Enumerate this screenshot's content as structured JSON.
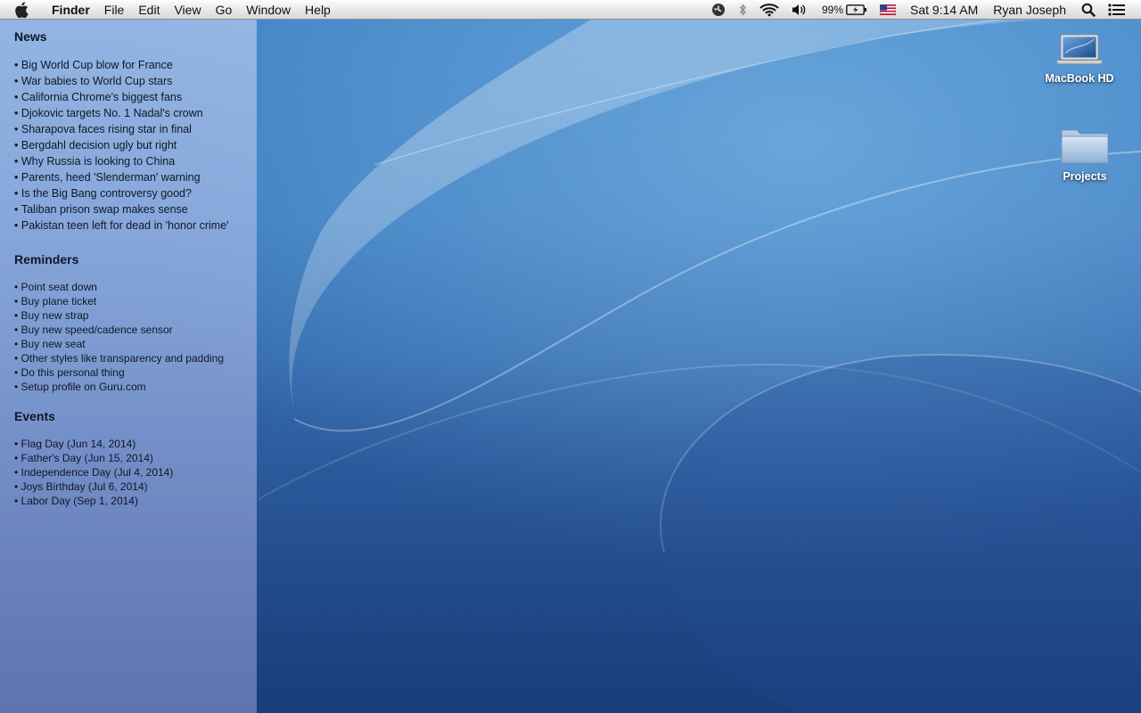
{
  "menubar": {
    "apple_menu": "apple-logo-icon",
    "app_name": "Finder",
    "items": [
      "File",
      "Edit",
      "View",
      "Go",
      "Window",
      "Help"
    ],
    "battery_percent": "99%",
    "clock": "Sat 9:14 AM",
    "user": "Ryan Joseph",
    "icons": [
      "time-machine-icon",
      "bluetooth-icon",
      "wifi-icon",
      "volume-icon",
      "battery-icon",
      "us-flag-input-icon",
      "spotlight-search-icon",
      "notification-center-icon"
    ]
  },
  "sidebar": {
    "news": {
      "title": "News",
      "items": [
        "Big World Cup blow for France",
        "War babies to World Cup stars",
        "California Chrome's biggest fans",
        "Djokovic targets No. 1 Nadal's crown",
        "Sharapova faces rising star in final",
        "Bergdahl decision ugly but right",
        "Why Russia is looking to China",
        "Parents, heed 'Slenderman' warning",
        "Is the Big Bang controversy good?",
        "Taliban prison swap makes sense",
        "Pakistan teen left for dead in 'honor crime'"
      ]
    },
    "reminders": {
      "title": "Reminders",
      "items": [
        "Point seat down",
        "Buy plane ticket",
        "Buy new strap",
        "Buy new speed/cadence sensor",
        "Buy new seat",
        "Other styles like transparency and padding",
        "Do this personal thing",
        "Setup profile on Guru.com"
      ]
    },
    "events": {
      "title": "Events",
      "items": [
        "Flag Day (Jun 14, 2014)",
        "Father's Day (Jun 15, 2014)",
        "Independence Day (Jul 4, 2014)",
        "Joys Birthday (Jul 6, 2014)",
        "Labor Day (Sep 1, 2014)"
      ]
    }
  },
  "desktop_icons": {
    "macbook": {
      "label": "MacBook HD",
      "icon": "laptop-drive-icon"
    },
    "projects": {
      "label": "Projects",
      "icon": "folder-icon"
    }
  },
  "colors": {
    "desktop_blue": "#3f83c6",
    "sidebar_tint": "#a6bde6"
  }
}
